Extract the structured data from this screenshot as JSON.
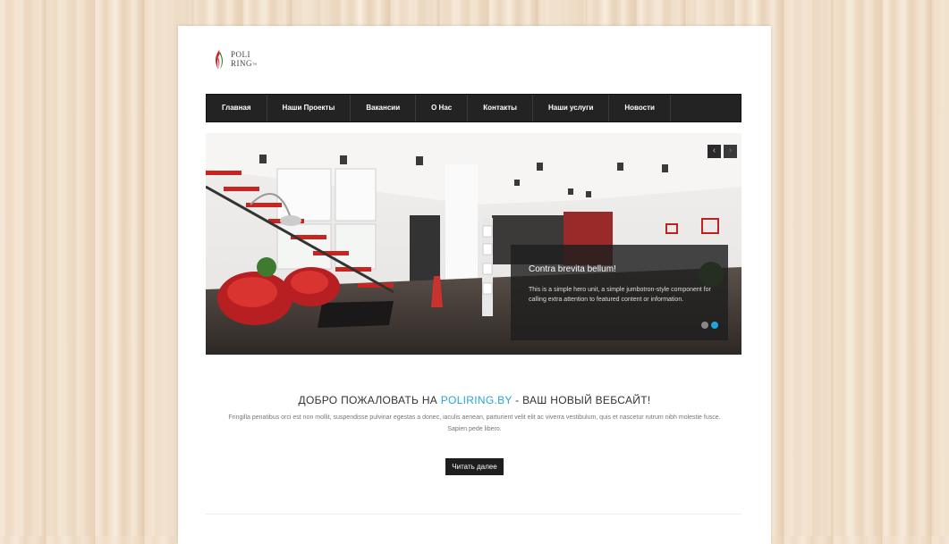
{
  "logo": {
    "line1": "POLI",
    "line2": "RING",
    "mark": "™"
  },
  "nav": {
    "items": [
      "Главная",
      "Наши Проекты",
      "Вакансии",
      "О Нас",
      "Контакты",
      "Наши услуги",
      "Новости"
    ]
  },
  "hero": {
    "prev_icon": "chevron-left-icon",
    "next_icon": "chevron-right-icon",
    "prev_glyph": "‹",
    "next_glyph": "›",
    "caption_title": "Contra brevita bellum!",
    "caption_text": "This is a simple hero unit, a simple jumbotron-style component for calling extra attention to featured content or information.",
    "dots": {
      "count": 2,
      "active_index": 1,
      "active_color": "#1fa6e0",
      "inactive_color": "#888888"
    }
  },
  "welcome": {
    "prefix": "ДОБРО ПОЖАЛОВАТЬ НА ",
    "site": "POLIRING.BY",
    "suffix": " - ВАШ НОВЫЙ ВЕБСАЙТ!",
    "accent_color": "#2aa3d8",
    "text": "Fringilla penatibus orci est non mollit, suspendisse pulvinar egestas a donec, iaculis aenean, parturient velit elit ac viverra vestibulum, quis et nascetur rutrum nibh molestie fusce. Sapien pede libero.",
    "button": "Читать далее"
  }
}
